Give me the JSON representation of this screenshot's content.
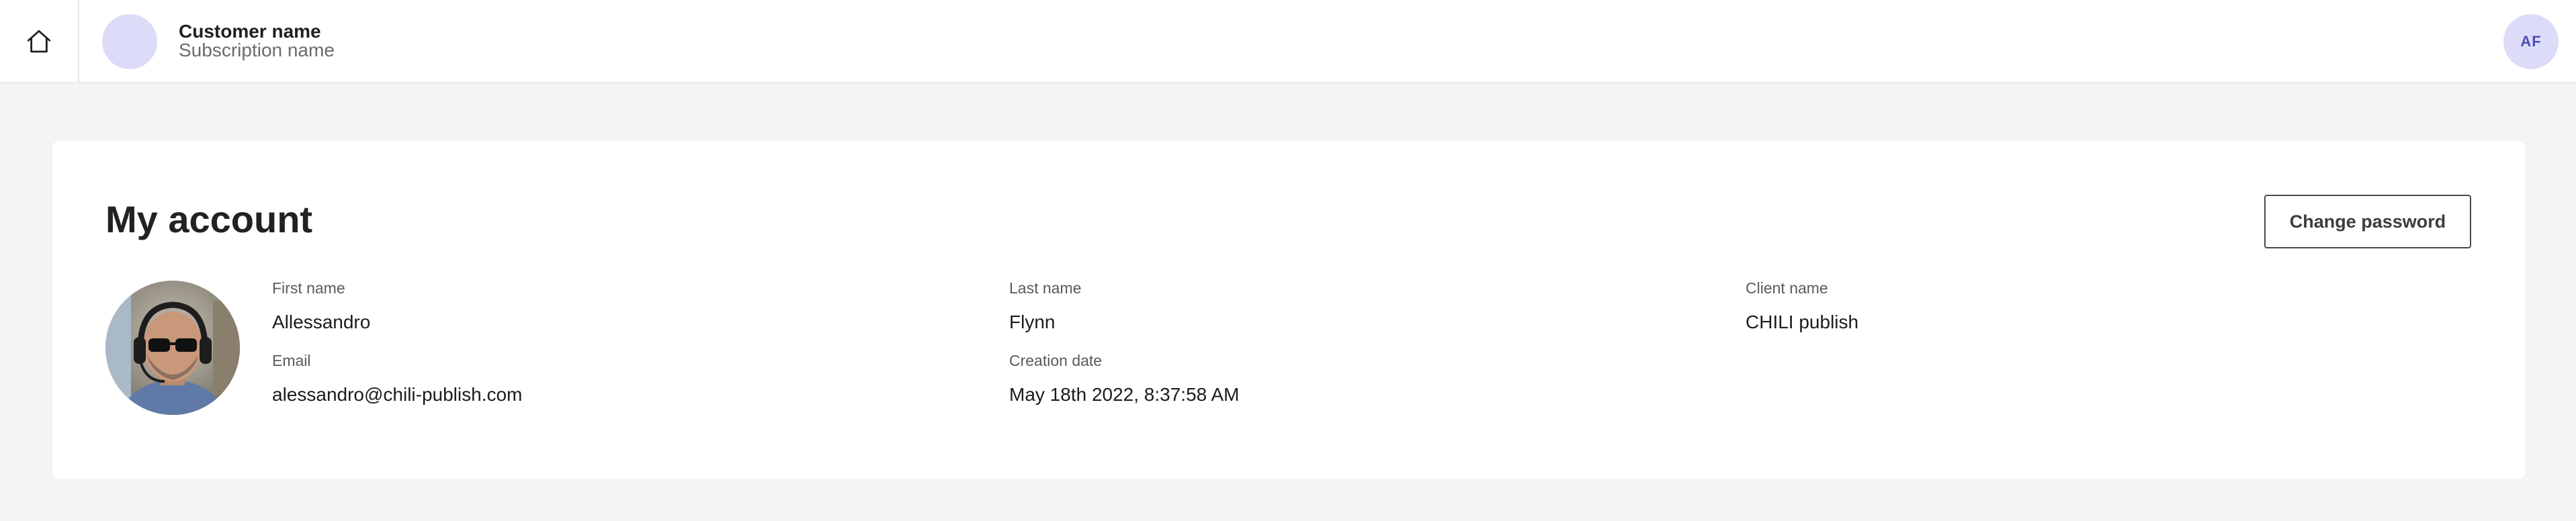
{
  "header": {
    "customer_name": "Customer name",
    "subscription_name": "Subscription name",
    "user_initials": "AF"
  },
  "account": {
    "title": "My account",
    "change_password_label": "Change password",
    "fields": {
      "first_name_label": "First name",
      "first_name": "Allessandro",
      "last_name_label": "Last name",
      "last_name": "Flynn",
      "client_name_label": "Client name",
      "client_name": "CHILI publish",
      "email_label": "Email",
      "email": "alessandro@chili-publish.com",
      "creation_date_label": "Creation date",
      "creation_date": "May 18th 2022, 8:37:58 AM"
    }
  },
  "colors": {
    "page_background": "#f4f4f4",
    "card_background": "#ffffff",
    "avatar_background": "#dcdcf8",
    "avatar_text": "#4a4fb4"
  },
  "icons": {
    "home": "home-icon"
  }
}
